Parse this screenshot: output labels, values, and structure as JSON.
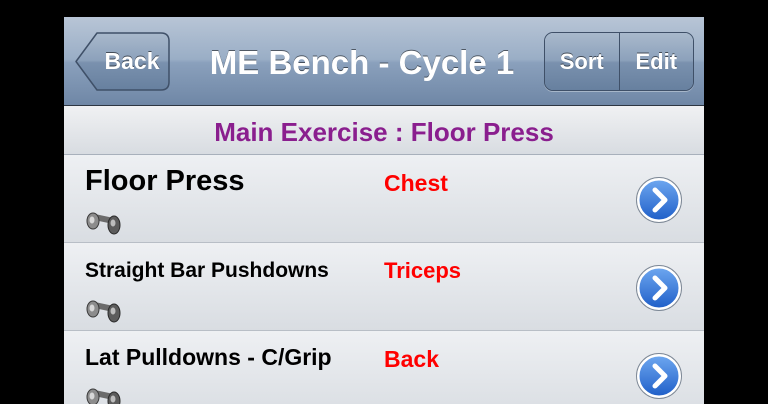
{
  "navbar": {
    "back_label": "Back",
    "title": "ME Bench - Cycle 1",
    "sort_label": "Sort",
    "edit_label": "Edit"
  },
  "section": {
    "title": "Main Exercise : Floor Press"
  },
  "rows": [
    {
      "name": "Floor Press",
      "muscle": "Chest",
      "icon": "dumbbell-icon"
    },
    {
      "name": "Straight Bar Pushdowns",
      "muscle": "Triceps",
      "icon": "dumbbell-icon"
    },
    {
      "name": "Lat Pulldowns - C/Grip",
      "muscle": "Back",
      "icon": "dumbbell-icon"
    }
  ],
  "colors": {
    "section_title": "#8a1e8e",
    "muscle": "#ff0000",
    "disclosure": "#2f74d8"
  }
}
